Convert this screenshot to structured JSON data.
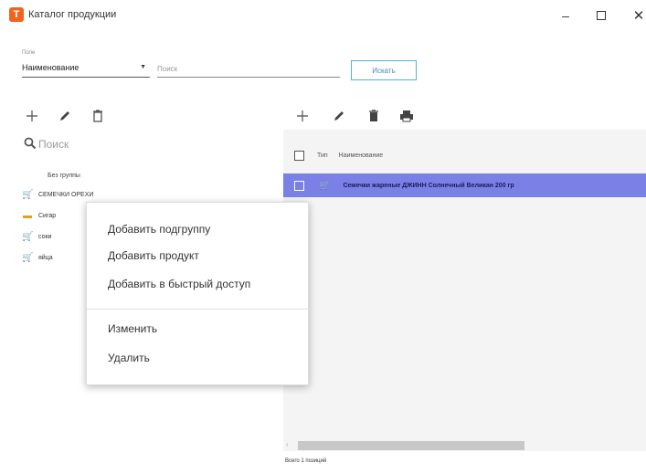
{
  "window": {
    "title": "Каталог продукции",
    "app_icon": "app-logo-icon",
    "minimize": "–",
    "close": "✕"
  },
  "search_bar": {
    "field_caption": "Поле",
    "field_value": "Наименование",
    "query_placeholder": "Поиск",
    "find_label": "Искать"
  },
  "left_panel": {
    "search_placeholder": "Поиск",
    "group_label": "Без группы",
    "tree": [
      {
        "icon": "cart-icon",
        "label": "СЕМЕЧКИ ОРЕХИ"
      },
      {
        "icon": "folder-icon",
        "label": "Сигар"
      },
      {
        "icon": "cart-icon",
        "label": "соки"
      },
      {
        "icon": "cart-icon",
        "label": "яйца"
      }
    ]
  },
  "grid": {
    "col_type": "Тип",
    "col_name": "Наименование",
    "rows": [
      {
        "name": "Семечки жареные ДЖИНН Солнечный Великан 200 гр",
        "selected": true
      }
    ],
    "status": "Всего 1 позиций"
  },
  "context_menu": {
    "items": [
      "Добавить подгруппу",
      "Добавить продукт",
      "Добавить в быстрый доступ"
    ],
    "items2": [
      "Изменить",
      "Удалить"
    ]
  },
  "colors": {
    "selection": "#7b80e6",
    "accent_button": "#58b0cf",
    "app_icon": "#f0641e"
  }
}
